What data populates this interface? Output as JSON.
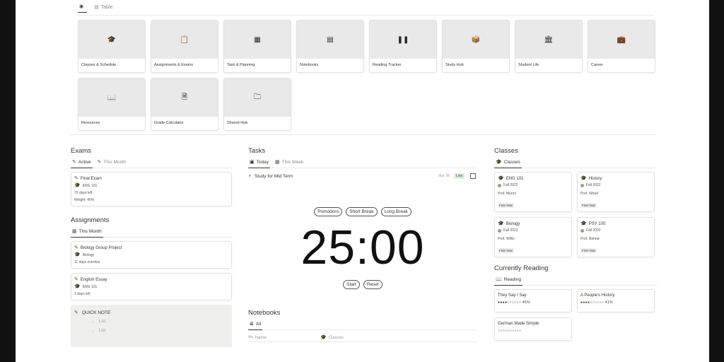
{
  "gallery": {
    "tabs": [
      {
        "label": "",
        "icon": "compass-icon"
      },
      {
        "label": "Table",
        "icon": "table-icon"
      }
    ],
    "cards": [
      {
        "title": "Classes & Schedule",
        "icon": "graduation-cap-icon",
        "glyph": "🎓"
      },
      {
        "title": "Assignments & Exams",
        "icon": "clipboard-icon",
        "glyph": "📋"
      },
      {
        "title": "Task & Planning",
        "icon": "calendar-icon",
        "glyph": "▦"
      },
      {
        "title": "Notebooks",
        "icon": "notebook-icon",
        "glyph": "▤"
      },
      {
        "title": "Reading Tracker",
        "icon": "book-open-icon",
        "glyph": "❚❚"
      },
      {
        "title": "Study Hub",
        "icon": "study-book-icon",
        "glyph": "📦"
      },
      {
        "title": "Student Life",
        "icon": "building-icon",
        "glyph": "🏛"
      },
      {
        "title": "Career",
        "icon": "briefcase-icon",
        "glyph": "💼"
      },
      {
        "title": "Resources",
        "icon": "open-book-icon",
        "glyph": "📖"
      },
      {
        "title": "Grade Calculator",
        "icon": "file-grade-icon",
        "glyph": "🗎"
      },
      {
        "title": "Shared Hub",
        "icon": "folder-share-icon",
        "glyph": "🗀"
      }
    ]
  },
  "exams": {
    "title": "Exams",
    "tabs": [
      {
        "label": "Active"
      },
      {
        "label": "This Month"
      }
    ],
    "items": [
      {
        "name": "Final Exam",
        "course": "ENG 101",
        "due": "79 days left",
        "weight": "Weight: 40%"
      }
    ]
  },
  "assignments": {
    "title": "Assignments",
    "tabs": [
      {
        "label": "This Month"
      }
    ],
    "items": [
      {
        "name": "Biology Group Project",
        "course": "Biology",
        "due": "11 days overdue"
      },
      {
        "name": "English Essay",
        "course": "ENG 101",
        "due": "2 days left"
      }
    ]
  },
  "quick_note": {
    "title": "QUICK NOTE",
    "items": [
      "List",
      "List"
    ]
  },
  "tasks": {
    "title": "Tasks",
    "tabs": [
      {
        "label": "Today"
      },
      {
        "label": "This Week"
      }
    ],
    "items": [
      {
        "name": "Study for Mid Term",
        "date": "Mar 28",
        "priority": "Low"
      }
    ]
  },
  "timer": {
    "modes": [
      "Pomodoro",
      "Short Break",
      "Long Break"
    ],
    "display": "25:00",
    "start_label": "Start",
    "reset_label": "Reset"
  },
  "notebooks": {
    "title": "Notebooks",
    "tabs": [
      {
        "label": "All"
      }
    ],
    "columns": [
      "Name",
      "Classes"
    ]
  },
  "classes": {
    "title": "Classes",
    "tabs": [
      {
        "label": "Classes"
      }
    ],
    "items": [
      {
        "name": "ENG 101",
        "term": "Fall 2022",
        "prof": "Prof. Munro",
        "year": "First Year"
      },
      {
        "name": "History",
        "term": "Fall 2022",
        "prof": "Prof. Wood",
        "year": "First Year"
      },
      {
        "name": "Biology",
        "term": "Fall 2022",
        "prof": "Prof. Willis",
        "year": "First Year"
      },
      {
        "name": "PSY 100",
        "term": "Fall 2022",
        "prof": "Prof. Bahrat",
        "year": "First Year"
      }
    ]
  },
  "reading": {
    "title": "Currently Reading",
    "tabs": [
      {
        "label": "Reading"
      }
    ],
    "items": [
      {
        "title": "They Say I Say",
        "progress_bar": "●●●●○○○○○○",
        "progress": "45%"
      },
      {
        "title": "A People's History",
        "progress_bar": "●●●●○○○○○○",
        "progress": "41%"
      },
      {
        "title": "German Made Simple",
        "progress_bar": "○○○○○○○○○○",
        "progress": ""
      }
    ]
  }
}
